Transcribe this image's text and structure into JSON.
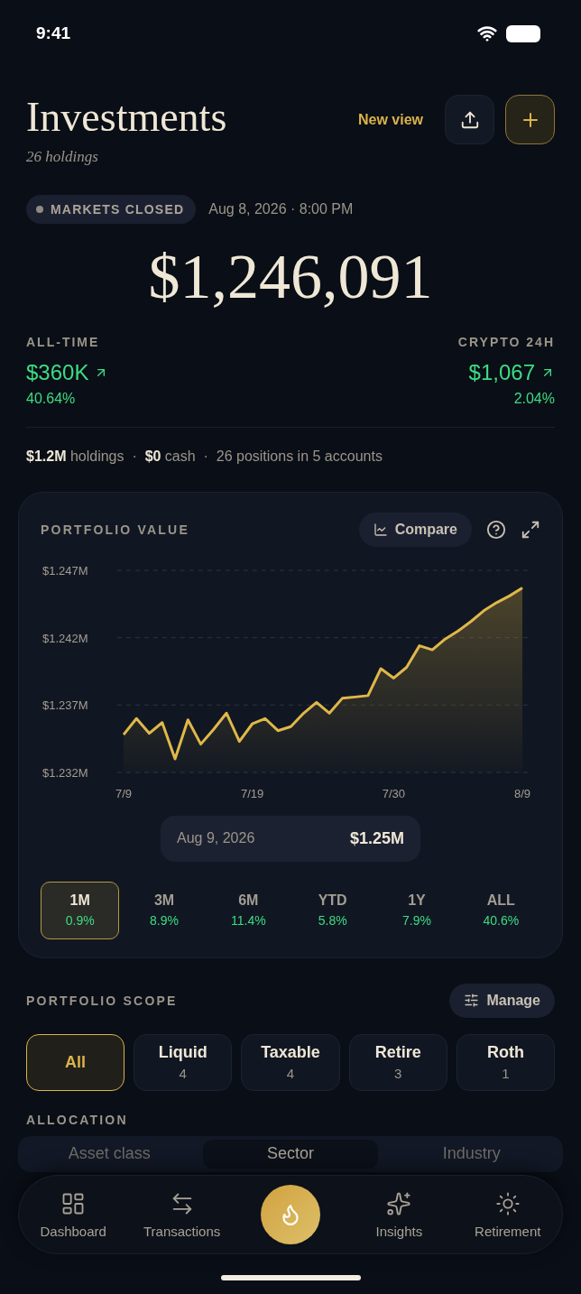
{
  "status_bar": {
    "time": "9:41"
  },
  "header": {
    "title": "Investments",
    "subtitle": "26 holdings",
    "new_view": "New view"
  },
  "market": {
    "status": "MARKETS CLOSED",
    "timestamp": "Aug 8, 2026 · 8:00 PM"
  },
  "total_value": "$1,246,091",
  "stats": [
    {
      "label": "ALL-TIME",
      "value": "$360K",
      "change": "40.64%"
    },
    {
      "label": "CRYPTO 24H",
      "value": "$1,067",
      "change": "2.04%"
    }
  ],
  "summary": "**$1.2M** holdings  ·  **$0** cash  ·  26 positions in 5 accounts",
  "chart_panel": {
    "title": "PORTFOLIO VALUE",
    "compare": "Compare",
    "chart_data": {
      "type": "area",
      "categories": [
        "7/9",
        null,
        null,
        null,
        null,
        null,
        null,
        null,
        null,
        null,
        "7/19",
        null,
        null,
        null,
        null,
        null,
        null,
        null,
        null,
        null,
        null,
        "7/30",
        null,
        null,
        null,
        null,
        null,
        null,
        null,
        null,
        null,
        "8/9"
      ],
      "series": [
        {
          "color": "#e0b84a",
          "values": [
            1.2348,
            1.236,
            1.2349,
            1.2357,
            1.233,
            1.2359,
            1.2341,
            1.2352,
            1.2364,
            1.2343,
            1.2356,
            1.236,
            1.2351,
            1.2354,
            1.2364,
            1.2372,
            1.2364,
            1.2375,
            1.2376,
            1.2377,
            1.2397,
            1.239,
            1.2398,
            1.2414,
            1.2411,
            1.2419,
            1.2425,
            1.2432,
            1.244,
            1.2446,
            1.2451,
            1.2457
          ]
        }
      ],
      "ylim": [
        1.232,
        1.247
      ],
      "yticks": [
        {
          "value": 1.247,
          "label": "$1.247M"
        },
        {
          "value": 1.242,
          "label": "$1.242M"
        },
        {
          "value": 1.237,
          "label": "$1.237M"
        },
        {
          "value": 1.232,
          "label": "$1.232M"
        }
      ]
    },
    "tooltip": {
      "date": "Aug 9, 2026",
      "value": "$1.25M"
    },
    "ranges": [
      {
        "label": "1M",
        "change": "0.9%",
        "selected": true
      },
      {
        "label": "3M",
        "change": "8.9%",
        "selected": false
      },
      {
        "label": "6M",
        "change": "11.4%",
        "selected": false
      },
      {
        "label": "YTD",
        "change": "5.8%",
        "selected": false
      },
      {
        "label": "1Y",
        "change": "7.9%",
        "selected": false
      },
      {
        "label": "ALL",
        "change": "40.6%",
        "selected": false
      }
    ]
  },
  "scope": {
    "title": "PORTFOLIO SCOPE",
    "manage": "Manage",
    "chips": [
      {
        "label": "All",
        "selected": true
      },
      {
        "label": "Liquid",
        "count": "4",
        "selected": false
      },
      {
        "label": "Taxable",
        "count": "4",
        "selected": false
      },
      {
        "label": "Retire",
        "count": "3",
        "selected": false
      },
      {
        "label": "Roth",
        "count": "1",
        "selected": false
      }
    ]
  },
  "allocation": {
    "title": "ALLOCATION",
    "tabs": [
      {
        "label": "Asset class",
        "selected": false
      },
      {
        "label": "Sector",
        "selected": true
      },
      {
        "label": "Industry",
        "selected": false
      }
    ]
  },
  "nav": [
    {
      "kind": "item",
      "label": "Dashboard"
    },
    {
      "kind": "item",
      "label": "Transactions"
    },
    {
      "kind": "action"
    },
    {
      "kind": "item",
      "label": "Insights"
    },
    {
      "kind": "item",
      "label": "Retirement"
    }
  ]
}
